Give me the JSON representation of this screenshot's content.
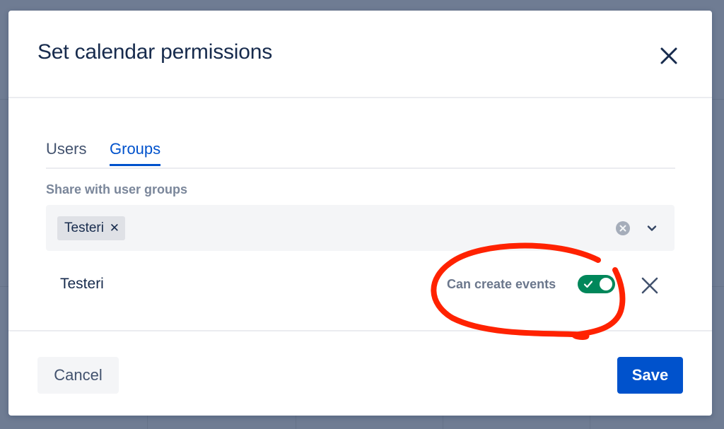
{
  "dialog": {
    "title": "Set calendar permissions"
  },
  "tabs": [
    {
      "label": "Users",
      "active": false
    },
    {
      "label": "Groups",
      "active": true
    }
  ],
  "share_field": {
    "label": "Share with user groups",
    "selected_chips": [
      "Testeri"
    ]
  },
  "group_rows": [
    {
      "name": "Testeri",
      "permission_label": "Can create events",
      "permission_enabled": true
    }
  ],
  "footer": {
    "cancel_label": "Cancel",
    "save_label": "Save"
  },
  "icons": {
    "close": "close-icon",
    "chip_remove": "small-x-icon",
    "clear": "clear-circle-icon",
    "dropdown": "chevron-down-icon",
    "toggle_on": "check-icon",
    "row_remove": "close-icon"
  },
  "colors": {
    "primary": "#0052cc",
    "toggle_on": "#00875a",
    "annotation": "#ff2200",
    "title_text": "#172b4d"
  },
  "glyphs": {
    "chip_remove": "✕"
  }
}
